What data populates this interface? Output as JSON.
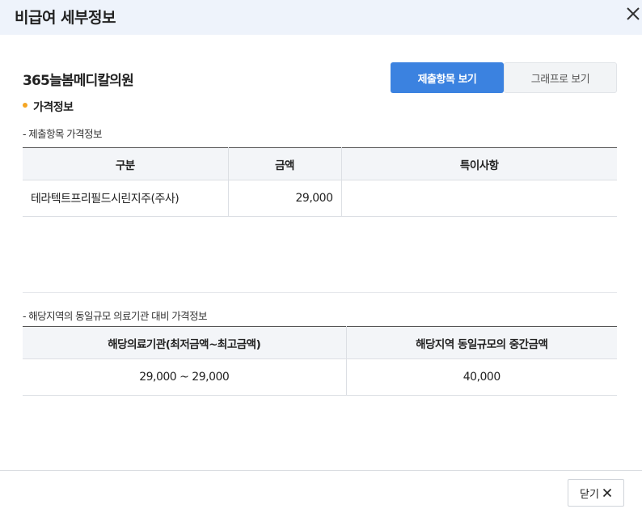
{
  "header": {
    "title": "비급여 세부정보"
  },
  "hospital": {
    "name": "365늘봄메디칼의원"
  },
  "view_toggle": {
    "list_label": "제출항목 보기",
    "graph_label": "그래프로 보기"
  },
  "section": {
    "title": "가격정보"
  },
  "submitted": {
    "subtitle": "- 제출항목 가격정보",
    "headers": [
      "구분",
      "금액",
      "특이사항"
    ],
    "rows": [
      {
        "item": "테라텍트프리필드시린지주(주사)",
        "amount": "29,000",
        "note": ""
      }
    ]
  },
  "comparison": {
    "subtitle": "- 해당지역의 동일규모 의료기관 대비 가격정보",
    "headers": [
      "해당의료기관(최저금액~최고금액)",
      "해당지역 동일규모의 중간금액"
    ],
    "rows": [
      {
        "range": "29,000 ~ 29,000",
        "median": "40,000"
      }
    ]
  },
  "footer": {
    "close_label": "닫기"
  }
}
